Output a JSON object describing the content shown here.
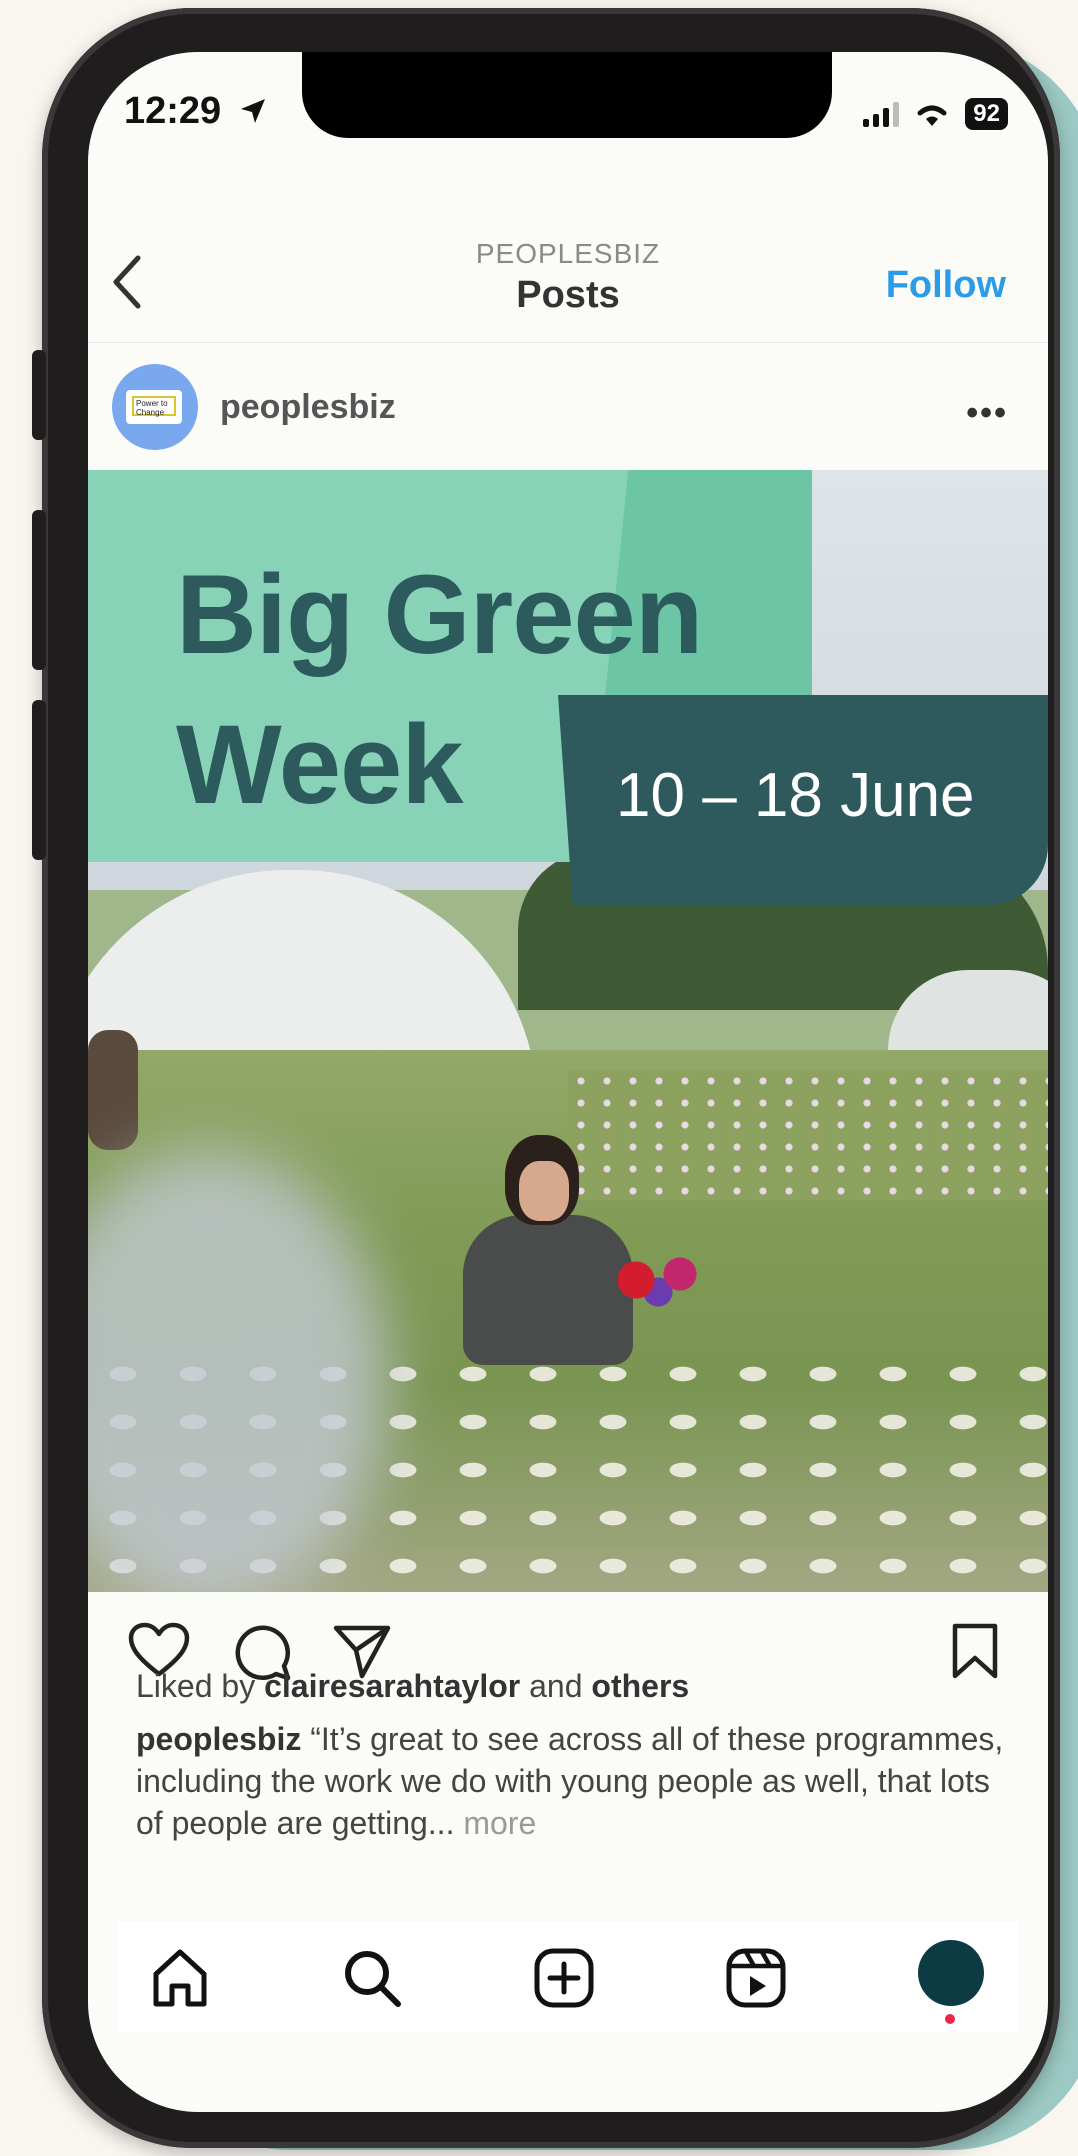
{
  "status_bar": {
    "time": "12:29",
    "battery": "92"
  },
  "header": {
    "username": "PEOPLESBIZ",
    "title": "Posts",
    "follow_label": "Follow"
  },
  "post": {
    "author": "peoplesbiz",
    "avatar_text": "Power to Change",
    "image": {
      "title_line1": "Big Green",
      "title_line2": "Week",
      "date": "10 – 18 June"
    },
    "likes_prefix": "Liked by",
    "liked_by_user": "clairesarahtaylor",
    "likes_middle": "and",
    "liked_by_others": "others",
    "caption_user": "peoplesbiz",
    "caption_text": "“It’s great to see across all of these programmes, including the work we do with young people as well, that lots of people are getting...",
    "more_label": "more"
  },
  "colors": {
    "accent": "#2a9ce8",
    "banner_green": "#88d2b8",
    "banner_dark": "#2f5a5d",
    "title_text": "#2d5a5c"
  }
}
